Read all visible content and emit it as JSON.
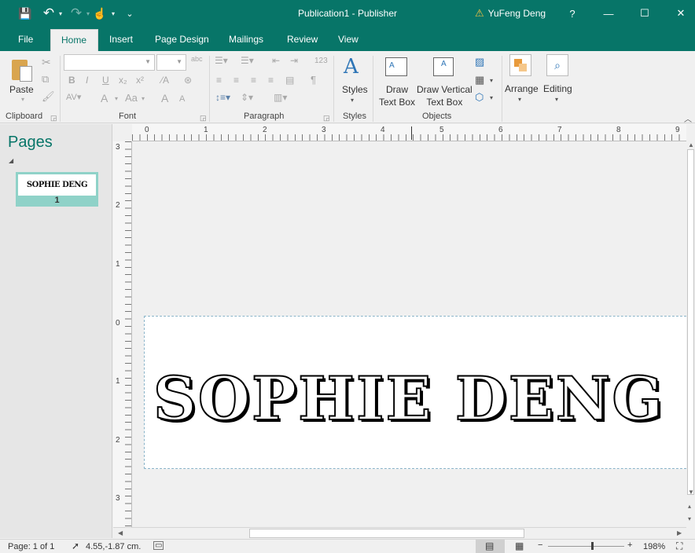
{
  "window": {
    "title": "Publication1  -  Publisher",
    "user": "YuFeng Deng",
    "help": "?",
    "minimize": "—",
    "maximize": "☐",
    "close": "✕"
  },
  "quick_access": {
    "save_icon": "💾",
    "undo_icon": "↶",
    "redo_icon": "↷",
    "touch_icon": "☝",
    "customize_icon": "⌄"
  },
  "tabs": [
    "File",
    "Home",
    "Insert",
    "Page Design",
    "Mailings",
    "Review",
    "View"
  ],
  "ribbon": {
    "groups": [
      "Clipboard",
      "Font",
      "Paragraph",
      "Styles",
      "Objects"
    ],
    "paste": "Paste",
    "styles": "Styles",
    "draw_text_box": [
      "Draw",
      "Text Box"
    ],
    "draw_vertical_text_box": [
      "Draw Vertical",
      "Text Box"
    ],
    "arrange": "Arrange",
    "editing": "Editing",
    "font_buttons": [
      "B",
      "I",
      "U",
      "x₂",
      "x²",
      "A",
      "Aa",
      "A",
      "A"
    ],
    "para_numbers": "123",
    "pilcrow": "¶"
  },
  "pages_pane": {
    "title": "Pages",
    "thumb_text": "SOPHIE DENG",
    "page_number": "1"
  },
  "rulers": {
    "horizontal": [
      "0",
      "1",
      "2",
      "3",
      "4",
      "5",
      "6",
      "7",
      "8",
      "9"
    ],
    "vertical": [
      "3",
      "2",
      "1",
      "0",
      "1",
      "2",
      "3"
    ]
  },
  "document": {
    "text": "SOPHIE DENG"
  },
  "status": {
    "page": "Page: 1 of 1",
    "position": "4.55,-1.87 cm.",
    "zoom": "198%",
    "zoom_level_fraction": 0.58
  },
  "colors": {
    "accent": "#077568",
    "thumb_highlight": "#8fd2c8"
  }
}
